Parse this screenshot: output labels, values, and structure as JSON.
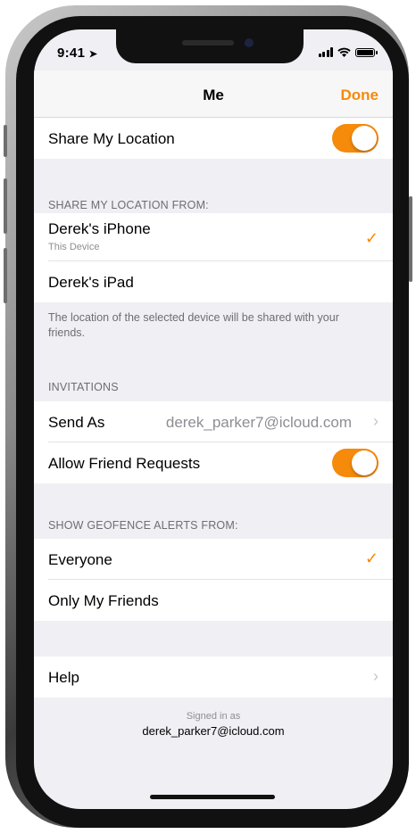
{
  "status_bar": {
    "time": "9:41",
    "location_arrow": "➤"
  },
  "nav": {
    "title": "Me",
    "done_label": "Done"
  },
  "share_location": {
    "label": "Share My Location",
    "enabled": true
  },
  "share_from": {
    "header": "SHARE MY LOCATION FROM:",
    "devices": [
      {
        "name": "Derek's iPhone",
        "subtitle": "This Device",
        "selected": true
      },
      {
        "name": "Derek's iPad",
        "subtitle": "",
        "selected": false
      }
    ],
    "footer": "The location of the selected device will be shared with your friends."
  },
  "invitations": {
    "header": "INVITATIONS",
    "send_as_label": "Send As",
    "send_as_value": "derek_parker7@icloud.com",
    "allow_requests_label": "Allow Friend Requests",
    "allow_requests_enabled": true
  },
  "geofence": {
    "header": "SHOW GEOFENCE ALERTS FROM:",
    "options": [
      {
        "label": "Everyone",
        "selected": true
      },
      {
        "label": "Only My Friends",
        "selected": false
      }
    ]
  },
  "help": {
    "label": "Help"
  },
  "account": {
    "signed_in_label": "Signed in as",
    "email": "derek_parker7@icloud.com"
  },
  "icons": {
    "checkmark": "✓",
    "chevron": "›"
  },
  "colors": {
    "accent": "#f58a0b",
    "background": "#efeff4",
    "secondary_text": "#8e8e93"
  }
}
